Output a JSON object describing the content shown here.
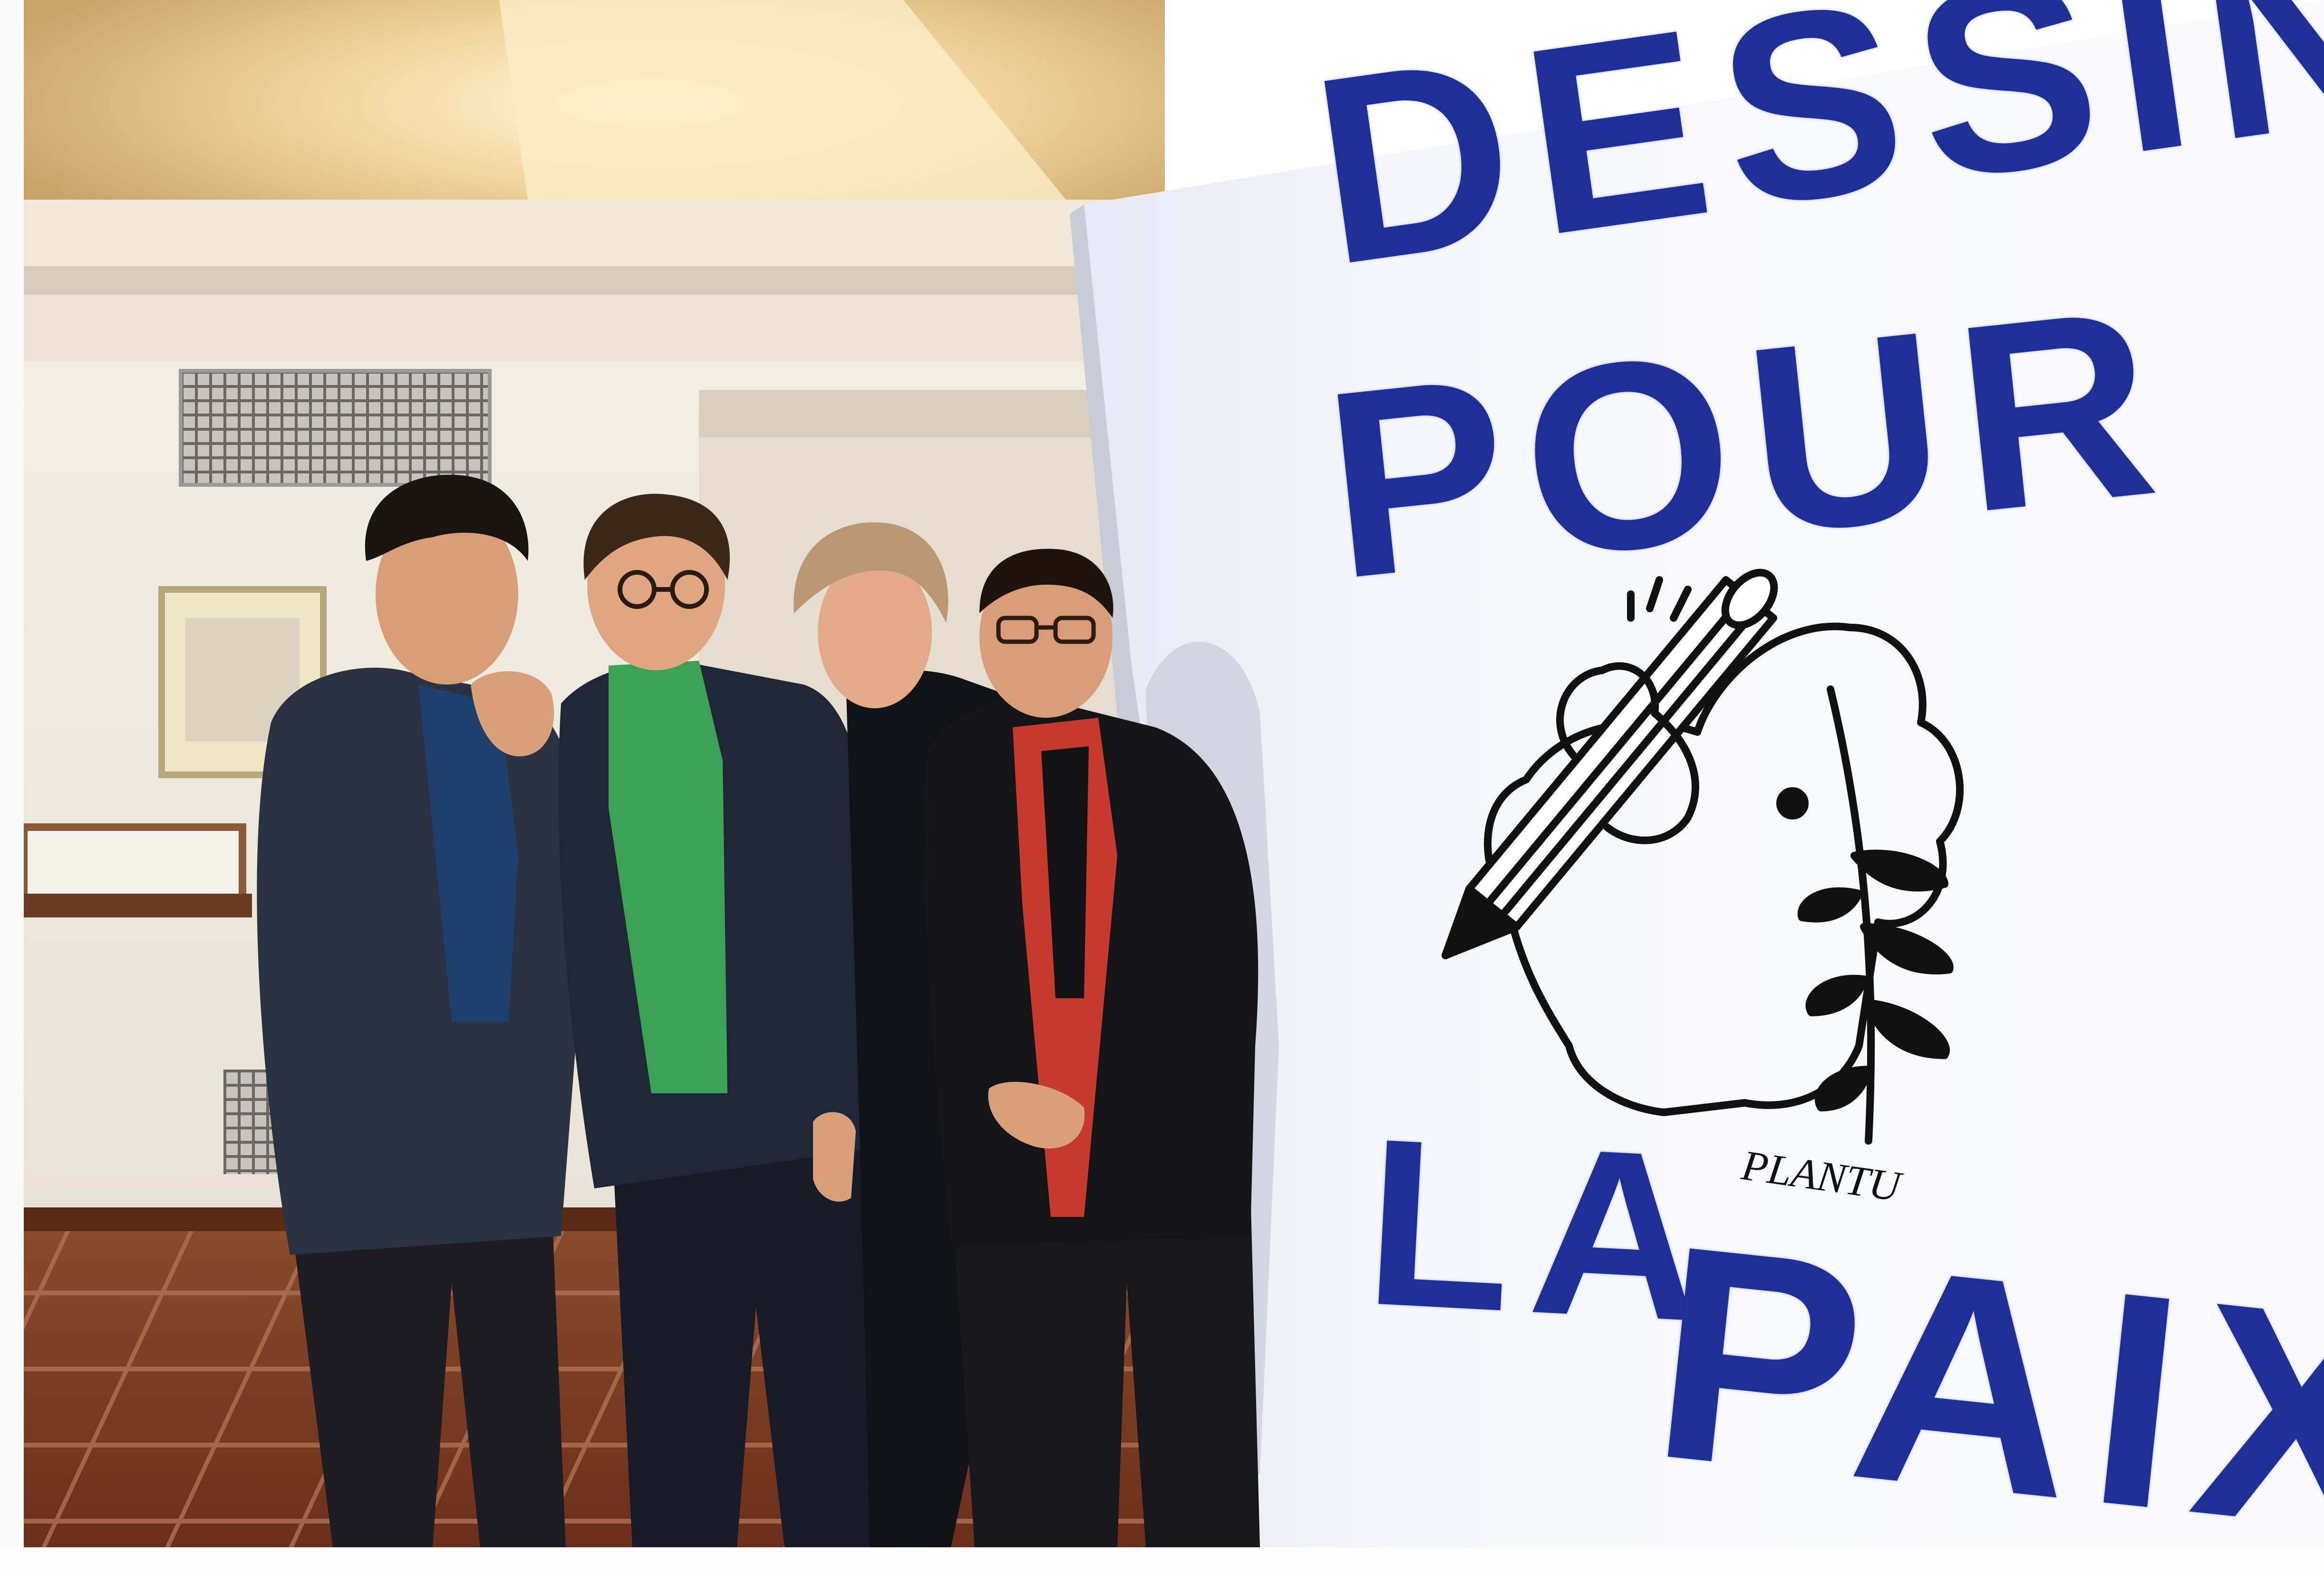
{
  "photo": {
    "description_icon": "photo-icon"
  },
  "poster": {
    "line1": "DESSINS",
    "line2": "POUR",
    "line3": "LA",
    "line4": "PAIX",
    "signature": "PLANTU",
    "text_color": "#1e2f97"
  },
  "colors": {
    "ceiling": "#e8c98f",
    "wall": "#f2eee6",
    "floor": "#7a3a22",
    "poster_board": "#f7f8fc",
    "green_turtleneck": "#3aa155",
    "red_shirt": "#c63a2e"
  }
}
